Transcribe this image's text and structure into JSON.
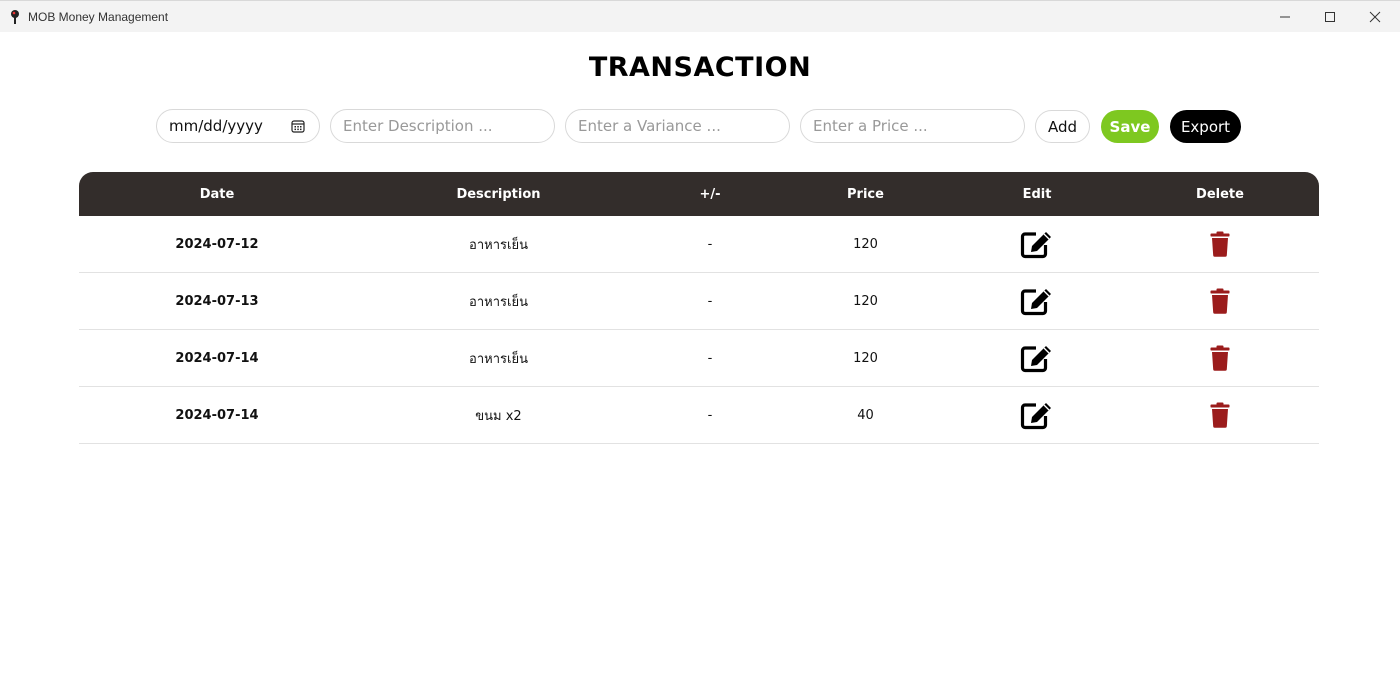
{
  "window": {
    "title": "MOB Money Management",
    "icon": "app-logo-icon",
    "controls": [
      "minimize-icon",
      "maximize-icon",
      "close-icon"
    ]
  },
  "page": {
    "title": "TRANSACTION"
  },
  "form": {
    "date_placeholder": "mm/dd/yyyy",
    "description_placeholder": "Enter Description ...",
    "variance_placeholder": "Enter a Variance ...",
    "price_placeholder": "Enter a Price ...",
    "add_label": "Add",
    "save_label": "Save",
    "export_label": "Export"
  },
  "table": {
    "headers": {
      "date": "Date",
      "description": "Description",
      "variance": "+/-",
      "price": "Price",
      "edit": "Edit",
      "delete": "Delete"
    },
    "rows": [
      {
        "date": "2024-07-12",
        "description": "อาหารเย็น",
        "variance": "-",
        "price": "120"
      },
      {
        "date": "2024-07-13",
        "description": "อาหารเย็น",
        "variance": "-",
        "price": "120"
      },
      {
        "date": "2024-07-14",
        "description": "อาหารเย็น",
        "variance": "-",
        "price": "120"
      },
      {
        "date": "2024-07-14",
        "description": "ขนม x2",
        "variance": "-",
        "price": "40"
      }
    ]
  },
  "colors": {
    "header_bg": "#332d2b",
    "save_bg": "#7ec820",
    "export_bg": "#000000",
    "delete_icon": "#9b1c1c"
  }
}
